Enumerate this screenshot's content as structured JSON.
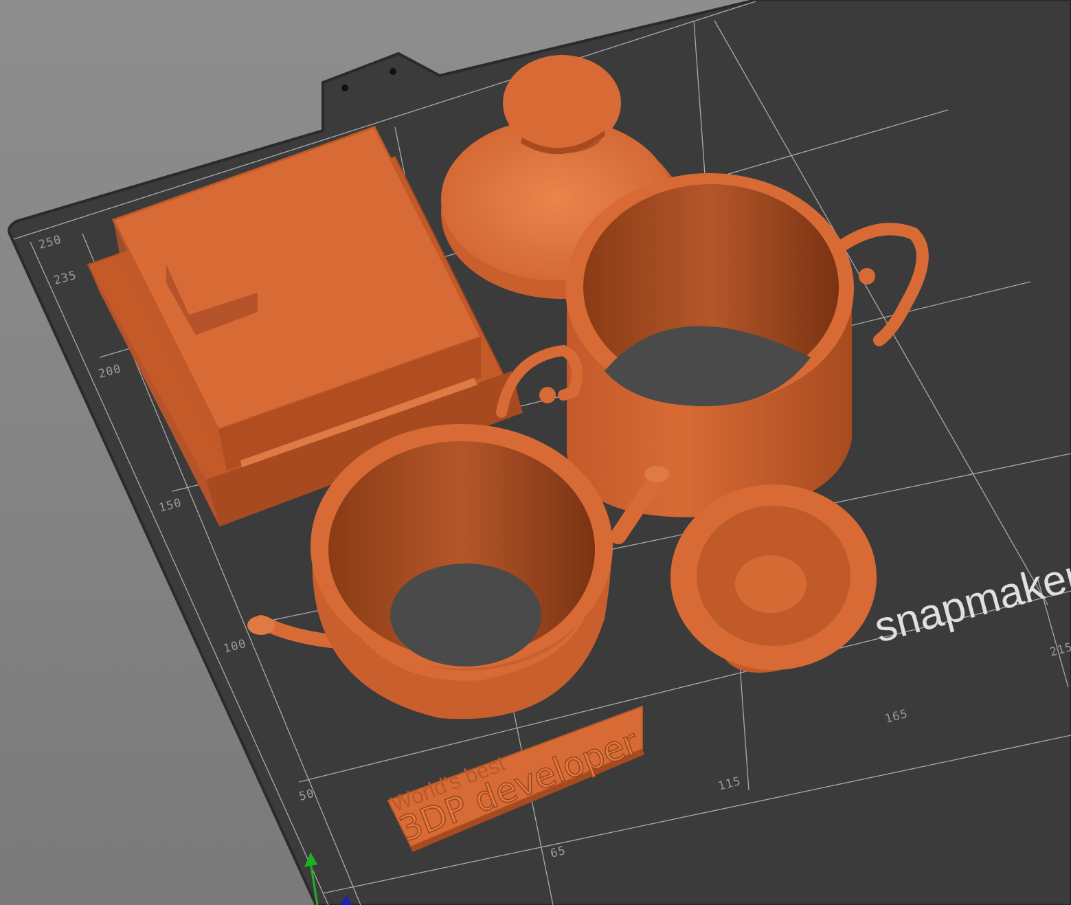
{
  "viewport": {
    "background_top": "#8e8e8e",
    "background_bottom": "#7a7a7a",
    "bed_color": "#3a3a3a",
    "bed_edge_color": "#2a2a2a",
    "grid_color": "#d8d8d8",
    "model_color": "#d86b35",
    "model_shadow": "#a84a20",
    "model_highlight": "#e9854d"
  },
  "bed": {
    "brand": "snapmaker",
    "axis_labels_y": [
      "250",
      "235",
      "200",
      "150",
      "100",
      "50"
    ],
    "axis_labels_x": [
      "65",
      "115",
      "165",
      "215"
    ]
  },
  "models": [
    {
      "name": "tea-box",
      "type": "box-with-lid"
    },
    {
      "name": "teapot-lid",
      "type": "lid-with-knob"
    },
    {
      "name": "sugar-bowl",
      "type": "cylinder-with-handles"
    },
    {
      "name": "teapot-body",
      "type": "bowl-with-spout"
    },
    {
      "name": "small-cup",
      "type": "cup"
    },
    {
      "name": "text-plate",
      "type": "embossed-text"
    }
  ],
  "plate_text": {
    "line1": "World's best",
    "line2": "3DP developer"
  },
  "gizmo": {
    "x_color": "#c02020",
    "y_color": "#20b020",
    "z_color": "#2020c0"
  }
}
